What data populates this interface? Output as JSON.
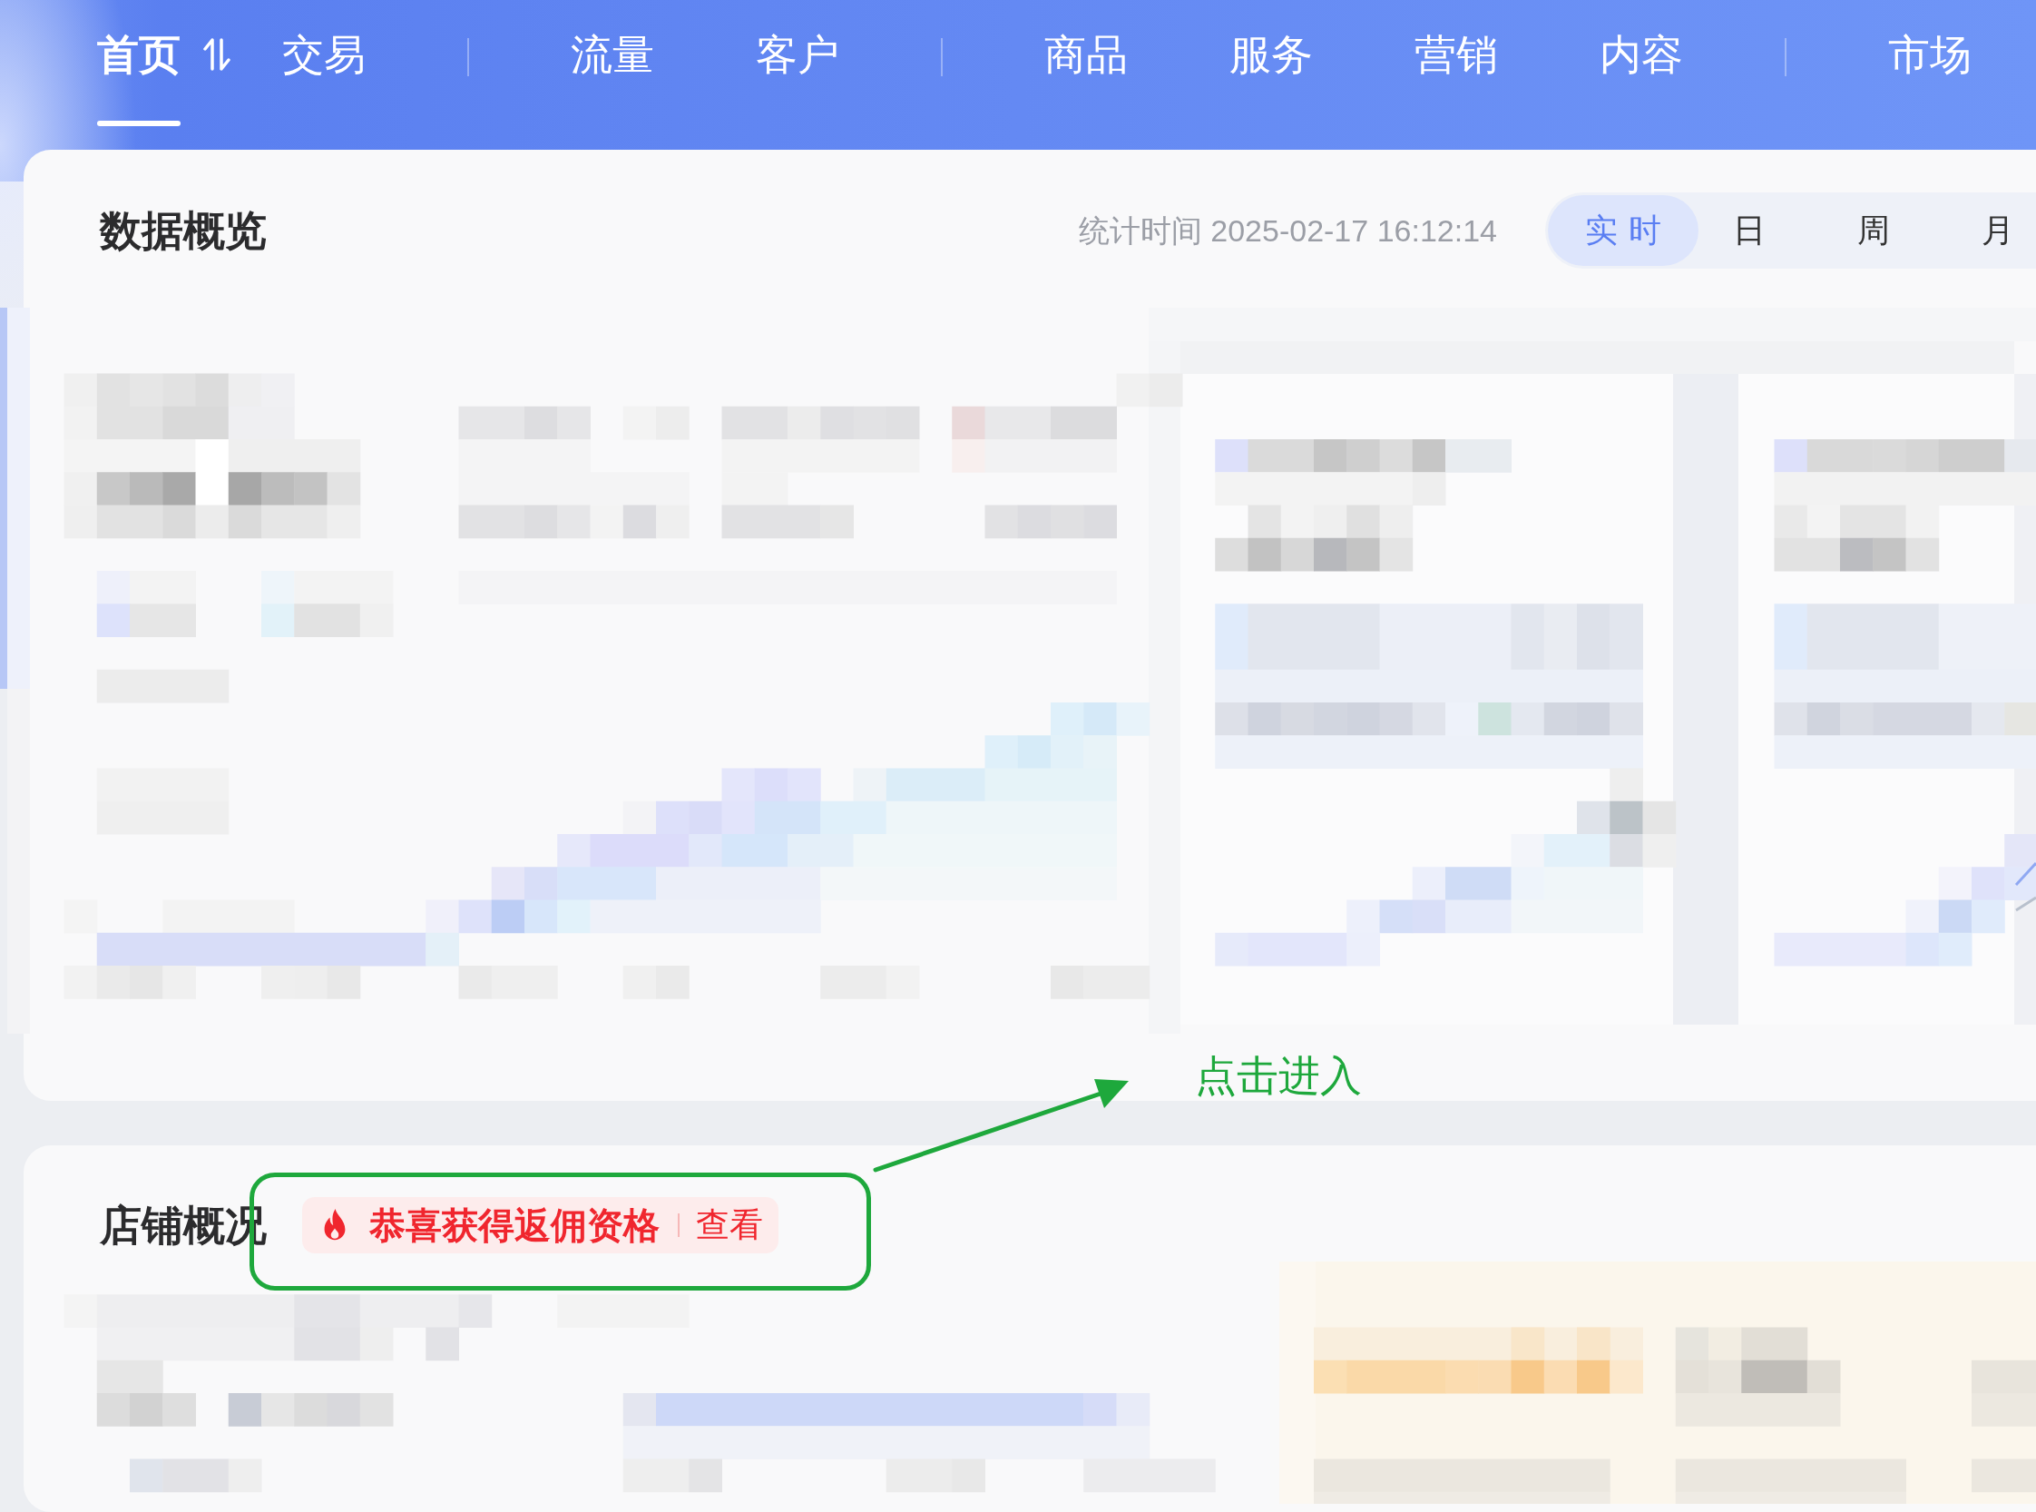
{
  "nav": {
    "groups": [
      {
        "items": [
          {
            "label": "首页",
            "selected": true,
            "kind": "switchable"
          },
          {
            "label": "交易",
            "selected": false,
            "kind": "plain"
          }
        ]
      },
      {
        "items": [
          {
            "label": "流量",
            "selected": false,
            "kind": "plain"
          },
          {
            "label": "客户",
            "selected": false,
            "kind": "plain"
          }
        ]
      },
      {
        "items": [
          {
            "label": "商品",
            "selected": false,
            "kind": "plain"
          },
          {
            "label": "服务",
            "selected": false,
            "kind": "plain"
          },
          {
            "label": "营销",
            "selected": false,
            "kind": "plain"
          },
          {
            "label": "内容",
            "selected": false,
            "kind": "plain"
          }
        ]
      },
      {
        "items": [
          {
            "label": "市场",
            "selected": false,
            "kind": "plain"
          }
        ]
      }
    ]
  },
  "overview": {
    "title": "数据概览",
    "stat_time": "统计时间 2025-02-17 16:12:14",
    "periods": [
      {
        "label": "实时",
        "selected": true
      },
      {
        "label": "日",
        "selected": false
      },
      {
        "label": "周",
        "selected": false
      },
      {
        "label": "月",
        "selected": false
      }
    ]
  },
  "store": {
    "title": "店铺概况",
    "badge": {
      "text": "恭喜获得返佣资格",
      "link": "查看"
    }
  },
  "annotation": {
    "text": "点击进入"
  }
}
